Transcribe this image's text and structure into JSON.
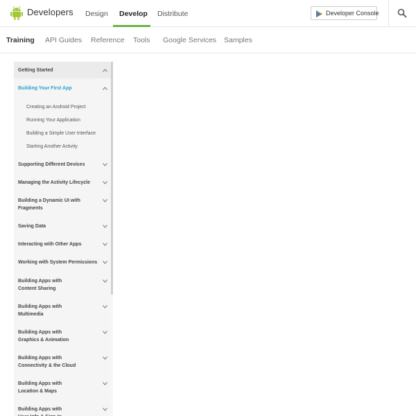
{
  "header": {
    "brand": "Developers",
    "brand_color": "#a4c639",
    "nav": [
      "Design",
      "Develop",
      "Distribute"
    ],
    "active_nav": "Develop",
    "accent_color": "#6ab344",
    "console_button": "Developer Console",
    "search_icon": "search-icon"
  },
  "subnav": {
    "items": [
      "Training",
      "API Guides",
      "Reference",
      "Tools",
      "Google Services",
      "Samples"
    ],
    "active": "Training"
  },
  "sidebar": {
    "items": [
      {
        "label": "Getting Started",
        "type": "section",
        "state": "expanded"
      },
      {
        "label": "Building Your First App",
        "type": "section",
        "state": "expanded-current"
      },
      {
        "label": "Creating an Android Project",
        "type": "sub"
      },
      {
        "label": "Running Your Application",
        "type": "sub"
      },
      {
        "label": "Building a Simple User Interface",
        "type": "sub"
      },
      {
        "label": "Starting Another Activity",
        "type": "sub"
      },
      {
        "label": "Supporting Different Devices",
        "type": "section",
        "state": "collapsed"
      },
      {
        "label": "Managing the Activity Lifecycle",
        "type": "section",
        "state": "collapsed"
      },
      {
        "label": "Building a Dynamic UI with Fragments",
        "type": "section",
        "state": "collapsed"
      },
      {
        "label": "Saving Data",
        "type": "section",
        "state": "collapsed"
      },
      {
        "label": "Interacting with Other Apps",
        "type": "section",
        "state": "collapsed"
      },
      {
        "label": "Working with System Permissions",
        "type": "section",
        "state": "collapsed"
      },
      {
        "label": "Building Apps with Content Sharing",
        "type": "section",
        "state": "collapsed"
      },
      {
        "label": "Building Apps with Multimedia",
        "type": "section",
        "state": "collapsed"
      },
      {
        "label": "Building Apps with Graphics & Animation",
        "type": "section",
        "state": "collapsed"
      },
      {
        "label": "Building Apps with Connectivity & the Cloud",
        "type": "section",
        "state": "collapsed"
      },
      {
        "label": "Building Apps with Location & Maps",
        "type": "section",
        "state": "collapsed"
      },
      {
        "label": "Building Apps with User Info & Sign-In",
        "type": "section",
        "state": "collapsed"
      }
    ],
    "current_color": "#2aa0cf"
  }
}
